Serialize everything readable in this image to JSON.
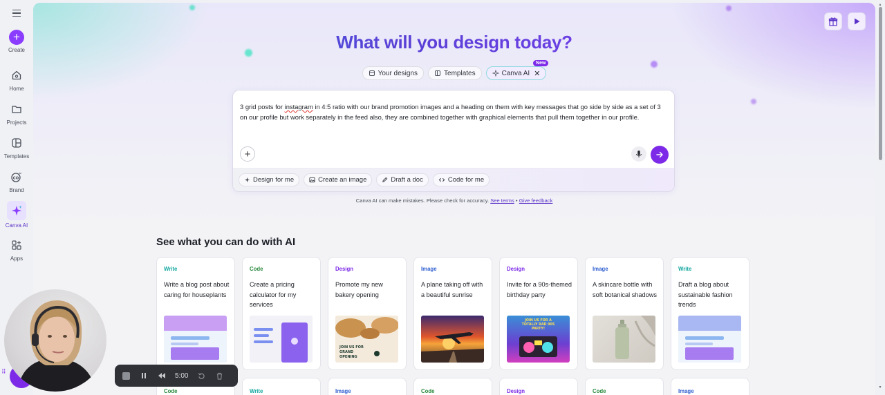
{
  "sidebar": {
    "menu_icon": "hamburger-icon",
    "items": [
      {
        "label": "Create",
        "icon": "plus-icon"
      },
      {
        "label": "Home",
        "icon": "home-icon"
      },
      {
        "label": "Projects",
        "icon": "folder-icon"
      },
      {
        "label": "Templates",
        "icon": "templates-icon"
      },
      {
        "label": "Brand",
        "icon": "brand-icon"
      },
      {
        "label": "Canva AI",
        "icon": "sparkle-icon"
      },
      {
        "label": "Apps",
        "icon": "apps-icon"
      }
    ]
  },
  "top_actions": {
    "gift_icon": "gift-icon",
    "play_icon": "play-icon"
  },
  "hero": {
    "title": "What will you design today?"
  },
  "tabs": [
    {
      "label": "Your designs",
      "icon": "doc-icon"
    },
    {
      "label": "Templates",
      "icon": "templates-icon"
    },
    {
      "label": "Canva AI",
      "icon": "sparkle-icon",
      "badge": "New",
      "active": true
    }
  ],
  "prompt": {
    "text": "3 grid posts for instagram in 4:5 ratio with our brand promotion images and a heading on them with key messages that go side by side as a set of 3 on our profile but work separately in the feed also, they are combined together with graphical elements that pull them together in our profile.",
    "misspelled": "instagram"
  },
  "chips": [
    {
      "label": "Design for me",
      "icon": "sparkle-icon"
    },
    {
      "label": "Create an image",
      "icon": "image-icon"
    },
    {
      "label": "Draft a doc",
      "icon": "pen-icon"
    },
    {
      "label": "Code for me",
      "icon": "code-icon"
    }
  ],
  "disclaimer": {
    "text": "Canva AI can make mistakes. Please check for accuracy.",
    "see_terms": "See terms",
    "separator": "•",
    "give_feedback": "Give feedback"
  },
  "section": {
    "title": "See what you can do with AI"
  },
  "cards": [
    {
      "category": "Write",
      "description": "Write a blog post about caring for houseplants"
    },
    {
      "category": "Code",
      "description": "Create a pricing calculator for my services"
    },
    {
      "category": "Design",
      "description": "Promote my new bakery opening",
      "thumb_text": "JOIN US FOR GRAND OPENING"
    },
    {
      "category": "Image",
      "description": "A plane taking off with a beautiful sunrise"
    },
    {
      "category": "Design",
      "description": "Invite for a 90s-themed birthday party",
      "thumb_text": "JOIN US FOR A TOTALLY RAD 90S PARTY!"
    },
    {
      "category": "Image",
      "description": "A skincare bottle with soft botanical shadows"
    },
    {
      "category": "Write",
      "description": "Draft a blog about sustainable fashion trends"
    }
  ],
  "cards_row2": [
    "Code",
    "Write",
    "Image",
    "Code",
    "Design",
    "Code",
    "Image"
  ],
  "recorder": {
    "time": "5:00"
  },
  "colors": {
    "accent": "#7d2ae8",
    "write": "#13a7a0",
    "code": "#2b8a3e",
    "design": "#7d2ae8",
    "image": "#2f5fd0"
  }
}
